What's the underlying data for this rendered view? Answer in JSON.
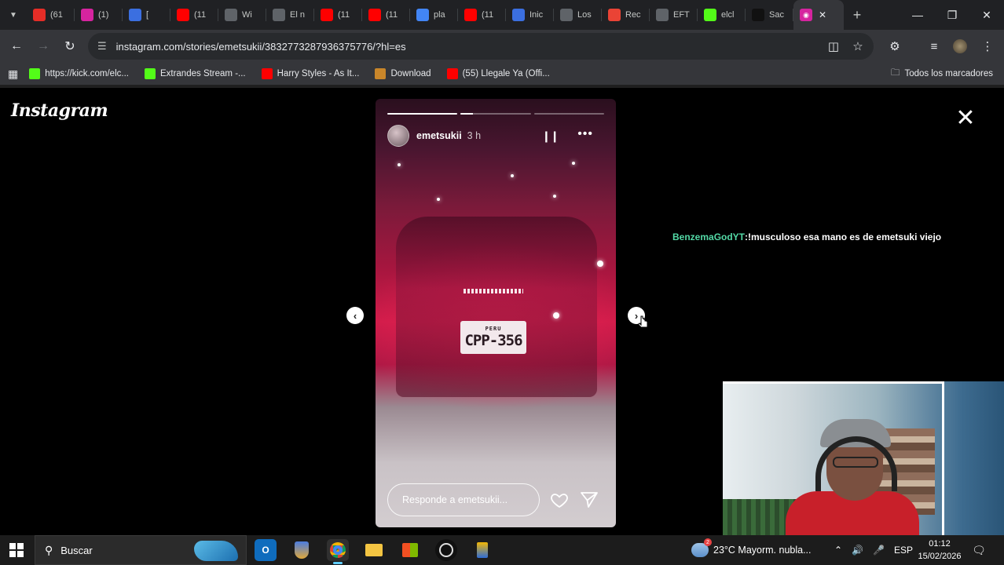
{
  "browser": {
    "tabs": [
      {
        "title": "(61",
        "icon": "kick-icon",
        "color": "#e52d27"
      },
      {
        "title": "(1)",
        "icon": "instagram-icon",
        "color": "#d6249f"
      },
      {
        "title": "[",
        "icon": "generic-blue-icon",
        "color": "#3b6fe0"
      },
      {
        "title": "(11",
        "icon": "youtube-icon",
        "color": "#ff0000"
      },
      {
        "title": "Wi",
        "icon": "wiki-icon",
        "color": "#5f6368"
      },
      {
        "title": "El n",
        "icon": "wiki-icon",
        "color": "#5f6368"
      },
      {
        "title": "(11",
        "icon": "youtube-icon",
        "color": "#ff0000"
      },
      {
        "title": "(11",
        "icon": "youtube-icon",
        "color": "#ff0000"
      },
      {
        "title": "pla",
        "icon": "google-icon",
        "color": "#4285f4"
      },
      {
        "title": "(11",
        "icon": "youtube-icon",
        "color": "#ff0000"
      },
      {
        "title": "Inic",
        "icon": "generic-blue-icon",
        "color": "#3b6fe0"
      },
      {
        "title": "Los",
        "icon": "nyt-icon",
        "color": "#5f6368"
      },
      {
        "title": "Rec",
        "icon": "gmail-icon",
        "color": "#ea4335"
      },
      {
        "title": "EFT",
        "icon": "globe-icon",
        "color": "#5f6368"
      },
      {
        "title": "elcl",
        "icon": "kick-icon",
        "color": "#53fc18"
      },
      {
        "title": "Sac",
        "icon": "tiktok-icon",
        "color": "#111111"
      }
    ],
    "active_tab_icon": "instagram-icon",
    "url": "instagram.com/stories/emetsukii/3832773287936375776/?hl=es",
    "bookmarks": [
      {
        "label": "https://kick.com/elc...",
        "icon": "kick-icon",
        "color": "#53fc18"
      },
      {
        "label": "Extrandes Stream -...",
        "icon": "kick-icon",
        "color": "#53fc18"
      },
      {
        "label": "Harry Styles - As It...",
        "icon": "youtube-icon",
        "color": "#ff0000"
      },
      {
        "label": "Download",
        "icon": "download-site-icon",
        "color": "#c9862a"
      },
      {
        "label": "(55) Llegale Ya (Offi...",
        "icon": "youtube-icon",
        "color": "#ff0000"
      }
    ],
    "all_bookmarks_label": "Todos los marcadores"
  },
  "instagram": {
    "logo_text": "Instagram",
    "story": {
      "username": "emetsukii",
      "time_ago": "3 h",
      "plate_country": "PERU",
      "plate_number": "CPP-356",
      "progress": [
        1.0,
        0.18,
        0.0
      ],
      "reply_placeholder": "Responde a emetsukii..."
    }
  },
  "chat_overlay": {
    "user": "BenzemaGodYT",
    "separator": ": ",
    "message": "!musculoso esa mano es de emetsuki viejo",
    "user_color": "#53d9a6"
  },
  "taskbar": {
    "search_placeholder": "Buscar",
    "weather_badge": "2",
    "weather_text": "23°C  Mayorm. nubla...",
    "language": "ESP",
    "time": "01:12",
    "date": "15/02/2026"
  }
}
